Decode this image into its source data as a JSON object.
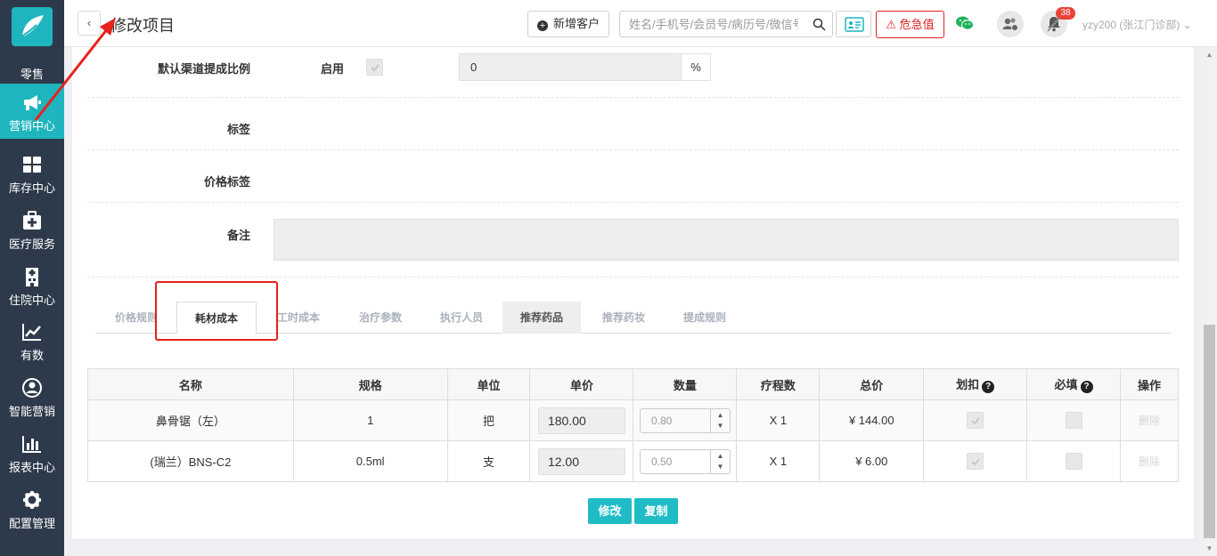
{
  "sidebar": {
    "items": [
      {
        "label": "零售",
        "icon": "retail-icon"
      },
      {
        "label": "营销中心",
        "icon": "megaphone-icon"
      },
      {
        "label": "库存中心",
        "icon": "grid-icon"
      },
      {
        "label": "医疗服务",
        "icon": "medical-kit-icon"
      },
      {
        "label": "住院中心",
        "icon": "hospital-building-icon"
      },
      {
        "label": "有数",
        "icon": "line-chart-icon"
      },
      {
        "label": "智能营销",
        "icon": "smart-user-icon"
      },
      {
        "label": "报表中心",
        "icon": "bar-chart-icon"
      },
      {
        "label": "配置管理",
        "icon": "gear-icon"
      }
    ],
    "active_index": 1
  },
  "header": {
    "back_label": "‹",
    "title": "修改项目",
    "new_customer": "新增客户",
    "search_placeholder": "姓名/手机号/会员号/病历号/微信号",
    "danger_label": "危急值",
    "notification_count": "38",
    "user": "yzy200 (张江门诊部)"
  },
  "form": {
    "commission_label": "默认渠道提成比例",
    "enable_label": "启用",
    "commission_value": "0",
    "commission_unit": "%",
    "tag_label": "标签",
    "price_tag_label": "价格标签",
    "remark_label": "备注"
  },
  "tabs": [
    {
      "label": "价格规则"
    },
    {
      "label": "耗材成本"
    },
    {
      "label": "工时成本"
    },
    {
      "label": "治疗参数"
    },
    {
      "label": "执行人员"
    },
    {
      "label": "推荐药品"
    },
    {
      "label": "推荐药妆"
    },
    {
      "label": "提成规则"
    }
  ],
  "table": {
    "headers": [
      "名称",
      "规格",
      "单位",
      "单价",
      "数量",
      "疗程数",
      "总价",
      "划扣",
      "必填",
      "操作"
    ],
    "rows": [
      {
        "name": "鼻骨锯（左）",
        "spec": "1",
        "unit": "把",
        "price": "180.00",
        "qty": "0.80",
        "course": "X 1",
        "total": "¥ 144.00",
        "action": "删除"
      },
      {
        "name": "(瑞兰）BNS-C2",
        "spec": "0.5ml",
        "unit": "支",
        "price": "12.00",
        "qty": "0.50",
        "course": "X 1",
        "total": "¥ 6.00",
        "action": "删除"
      }
    ]
  },
  "buttons": {
    "edit": "修改",
    "copy": "复制"
  },
  "colors": {
    "sidebar_bg": "#2d3a4b",
    "accent": "#1fb5be",
    "danger": "#e02020",
    "annotation": "#e6221b"
  }
}
